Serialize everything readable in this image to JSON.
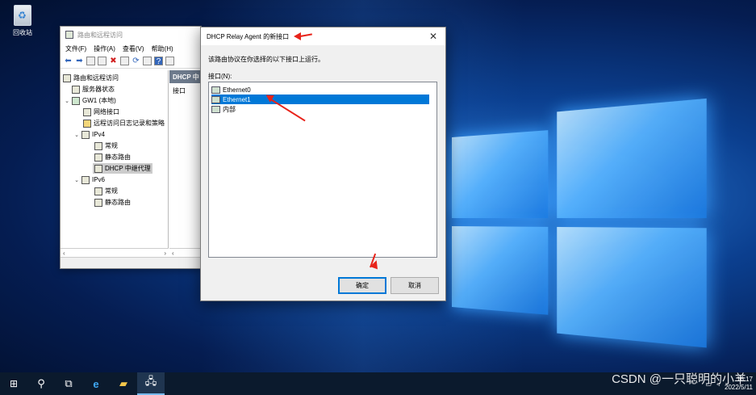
{
  "desktop": {
    "recycle_bin_label": "回收站"
  },
  "rras_window": {
    "title": "路由和远程访问",
    "menu": [
      "文件(F)",
      "操作(A)",
      "查看(V)",
      "帮助(H)"
    ],
    "tree": {
      "root": "路由和远程访问",
      "server_status": "服务器状态",
      "server": "GW1 (本地)",
      "network_interfaces": "网络接口",
      "remote_access_logging": "远程访问日志记录和策略",
      "ipv4": "IPv4",
      "ipv4_general": "常规",
      "ipv4_static_routes": "静态路由",
      "dhcp_relay": "DHCP 中继代理",
      "ipv6": "IPv6",
      "ipv6_general": "常规",
      "ipv6_static_routes": "静态路由"
    },
    "right_pane": {
      "header": "DHCP 中",
      "column": "接口"
    }
  },
  "dialog": {
    "title": "DHCP Relay Agent 的新接口",
    "description": "该路由协议在你选择的以下接口上运行。",
    "interfaces_label": "接口(N):",
    "interfaces": [
      "Ethernet0",
      "Ethernet1",
      "内部"
    ],
    "selected_interface": "Ethernet1",
    "ok_label": "确定",
    "cancel_label": "取消"
  },
  "taskbar": {
    "clock_time": "16:17",
    "clock_date": "2022/5/11"
  },
  "watermark": "CSDN @一只聪明的小羊",
  "colors": {
    "selection": "#0078d7",
    "annotation_arrow": "#e8231a",
    "taskbar": "#0b1a2d"
  }
}
